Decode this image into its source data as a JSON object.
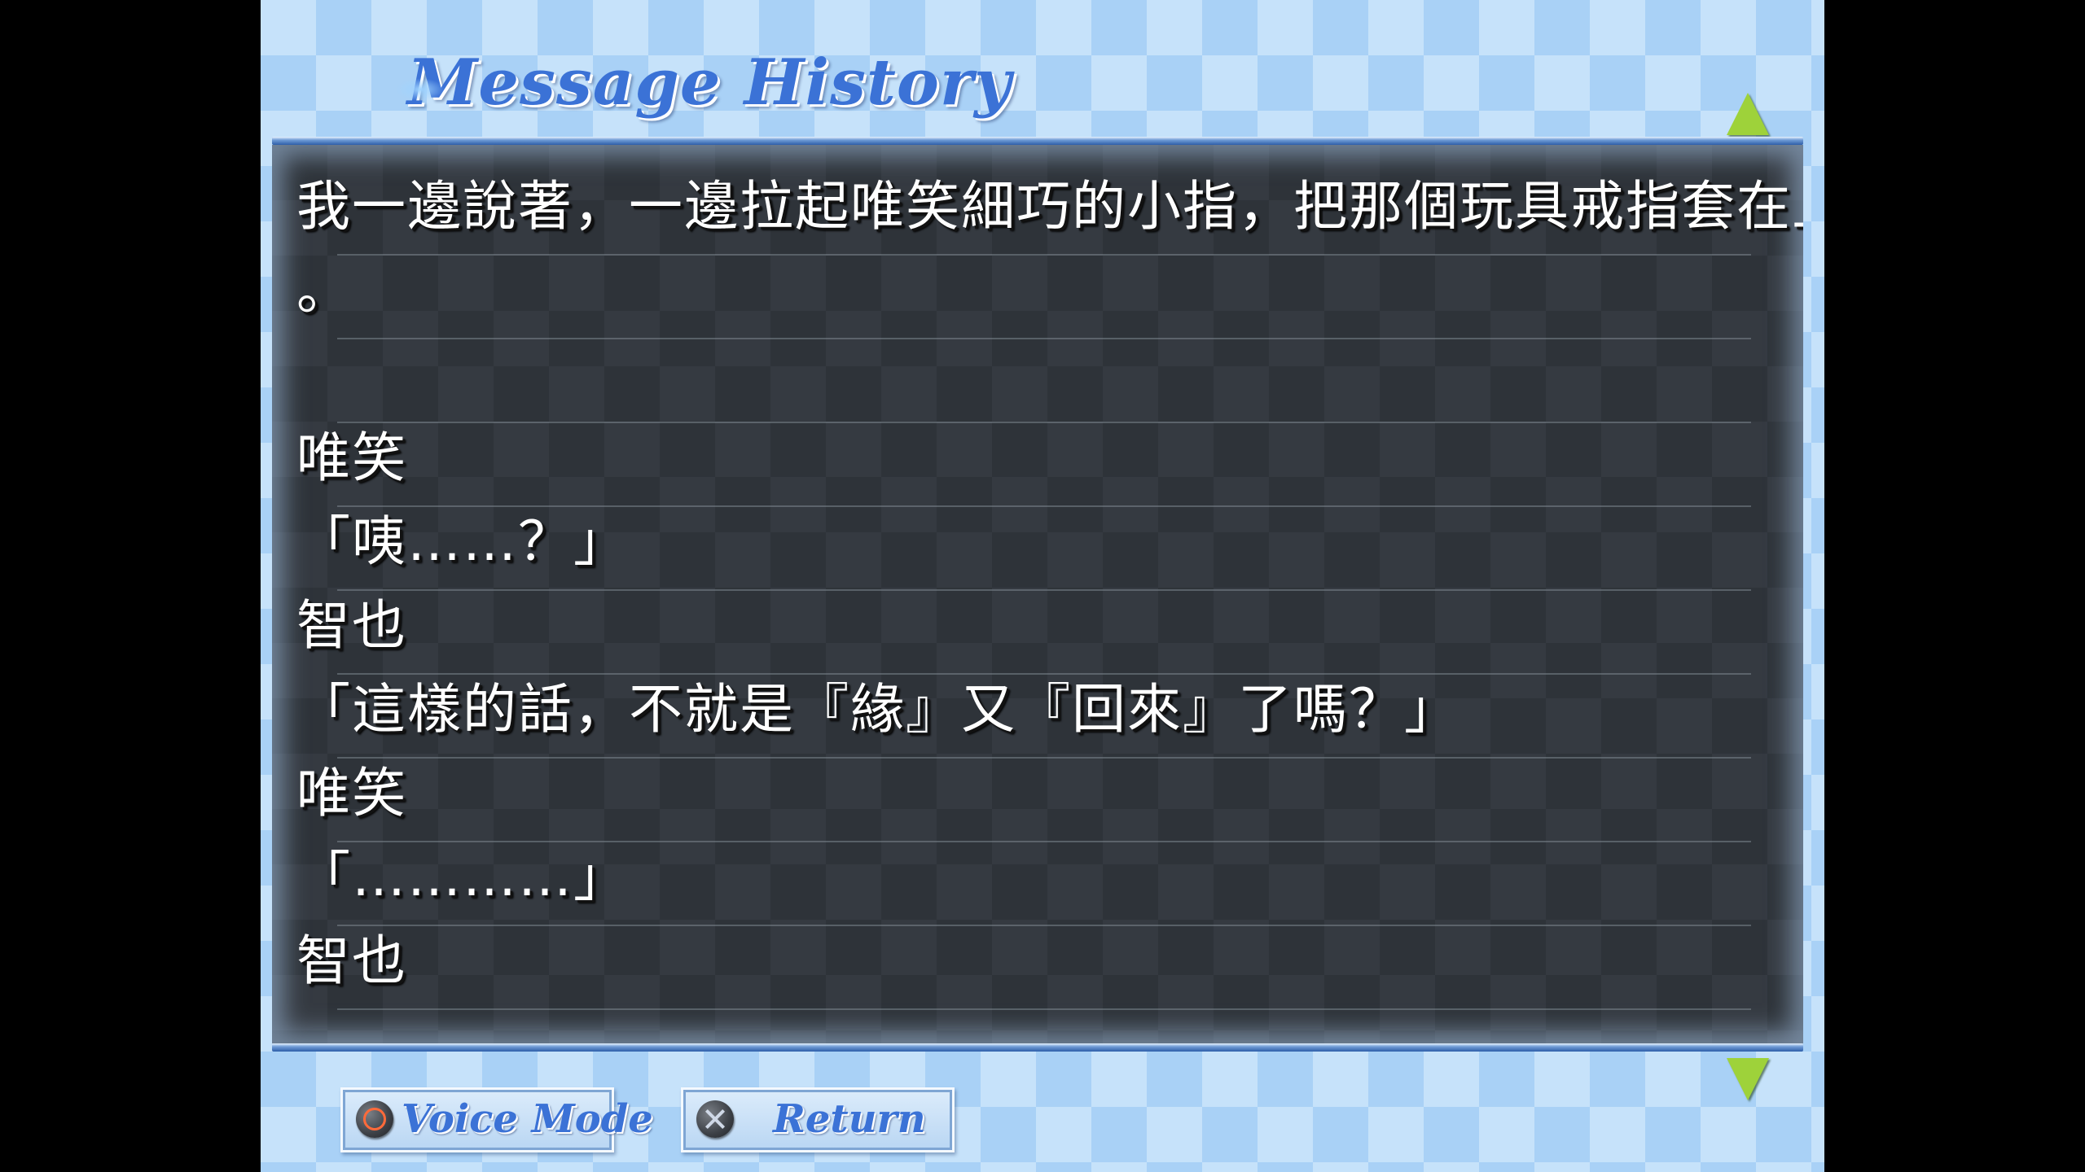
{
  "screen": {
    "title": "Message History"
  },
  "log": {
    "lines": [
      "我一邊說著，一邊拉起唯笑細巧的小指，把那個玩具戒指套在上面",
      "。",
      "",
      "唯笑",
      "「咦……？」",
      "智也",
      "「這樣的話，不就是『緣』又『回來』了嗎？」",
      "唯笑",
      "「…………」",
      "智也"
    ]
  },
  "buttons": {
    "voice_mode": {
      "label": "Voice Mode",
      "icon": "circle-button-icon"
    },
    "return": {
      "label": "Return",
      "icon": "cross-button-icon"
    }
  },
  "scroll": {
    "up_icon": "scroll-up-arrow-icon",
    "down_icon": "scroll-down-arrow-icon"
  },
  "colors": {
    "title": "#3b72d6",
    "arrow": "#9ed23a",
    "panel": "#2e3339",
    "background": "#c6e2fa"
  }
}
